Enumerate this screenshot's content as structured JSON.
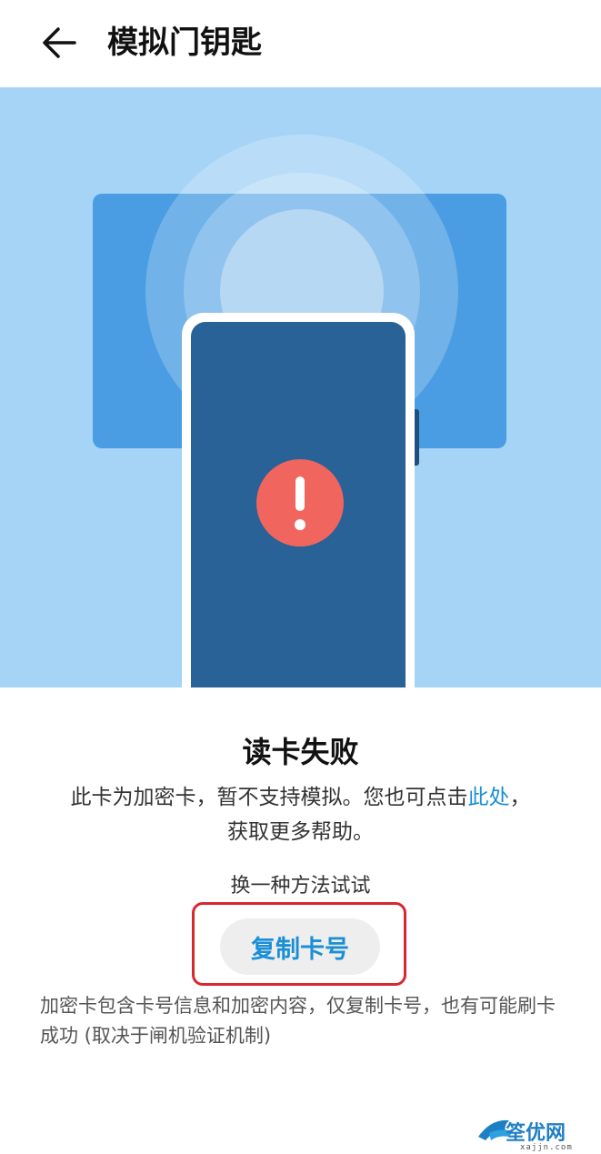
{
  "header": {
    "back_icon": "arrow-left-icon",
    "title": "模拟门钥匙"
  },
  "illustration": {
    "alert_icon": "exclamation-icon",
    "colors": {
      "background": "#a6d4f6",
      "card": "#4a9de2",
      "phone_screen": "#286296",
      "alert": "#f0655e"
    }
  },
  "status": {
    "title": "读卡失败",
    "desc_prefix": "此卡为加密卡，暂不支持模拟。您也可点击",
    "desc_link": "此处",
    "desc_suffix_line1": "，",
    "desc_line2": "获取更多帮助。"
  },
  "alternative": {
    "hint": "换一种方法试试",
    "copy_button": "复制卡号"
  },
  "note": "加密卡包含卡号信息和加密内容，仅复制卡号，也有可能刷卡成功 (取决于闸机验证机制)",
  "watermark": {
    "text": "筌优网",
    "url": "xajjn.com"
  }
}
